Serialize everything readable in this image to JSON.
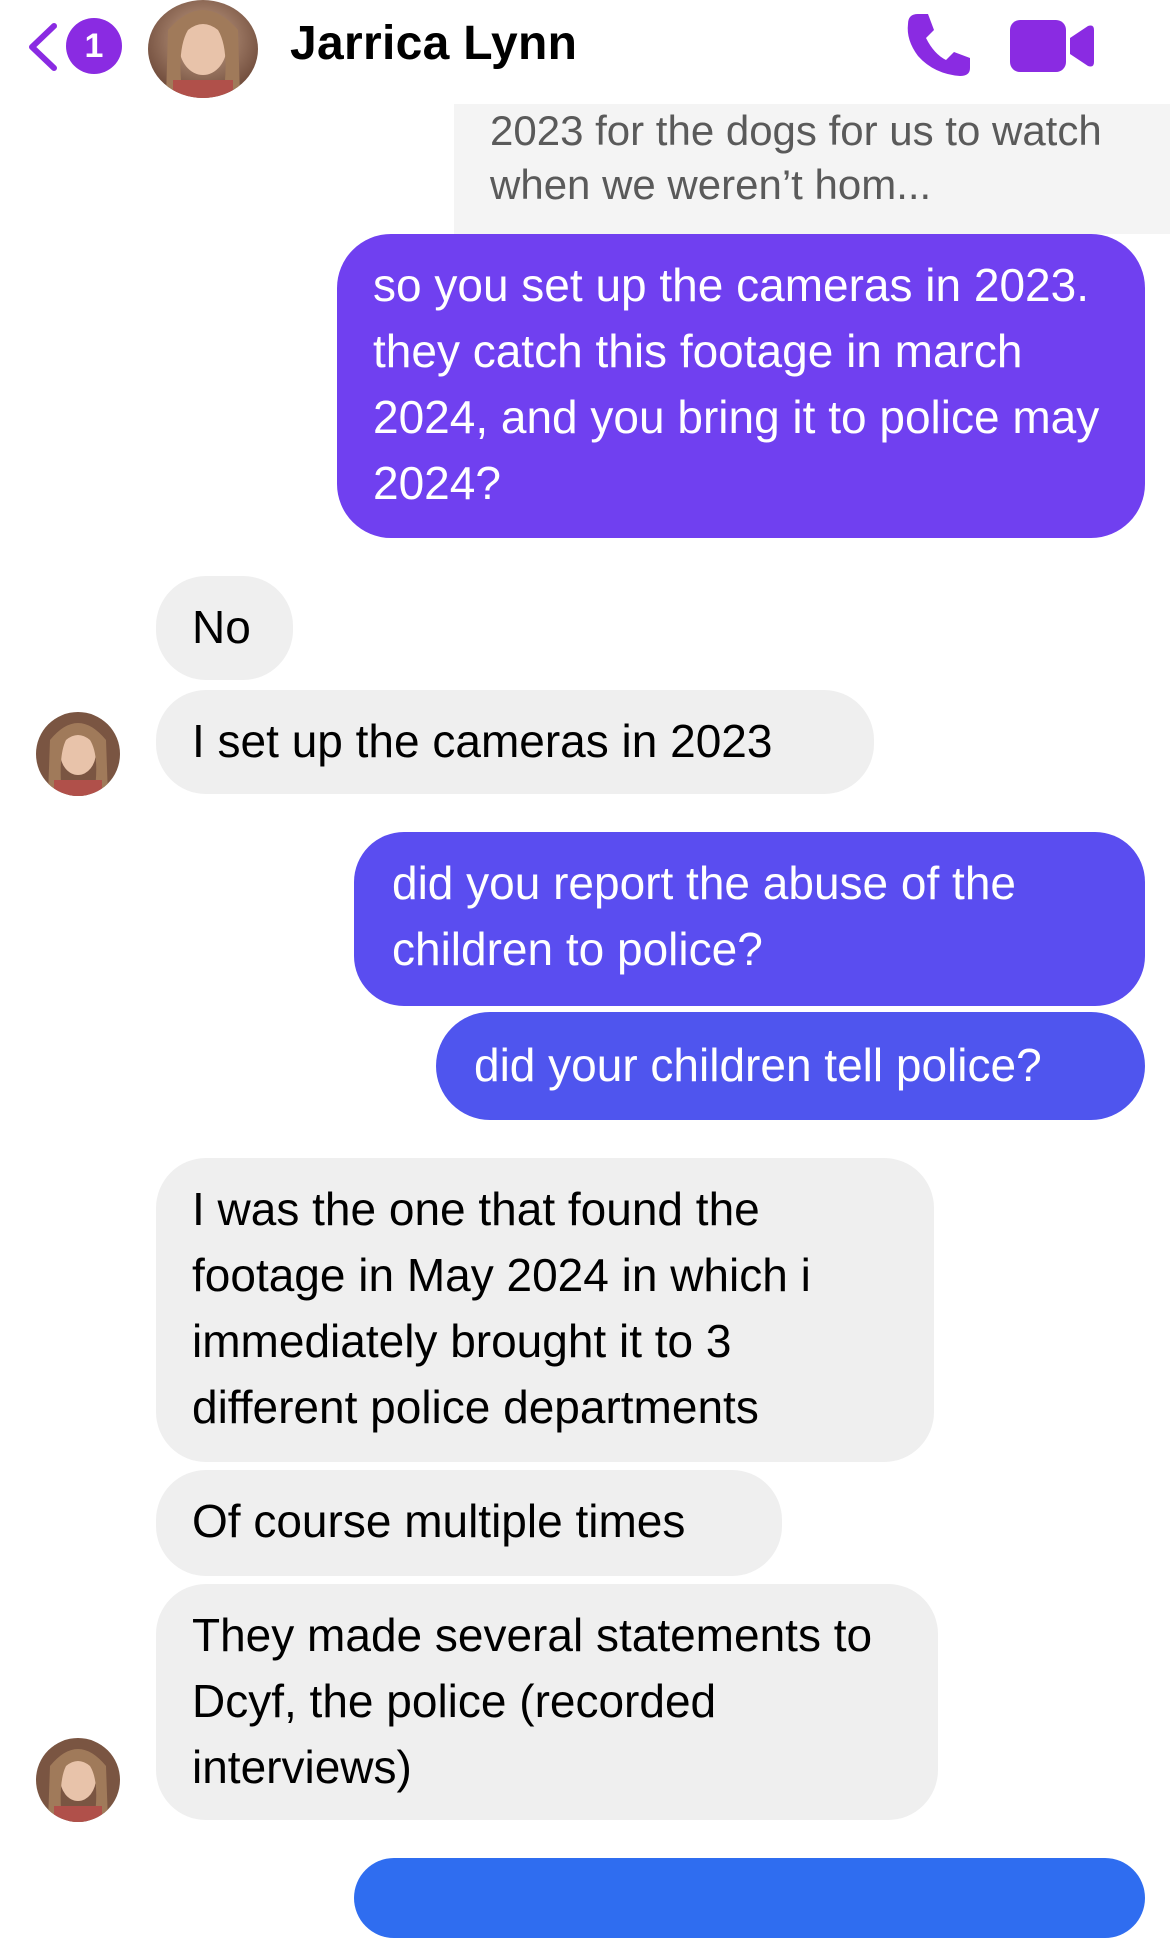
{
  "header": {
    "unread_count": "1",
    "contact_name": "Jarrica Lynn",
    "icons": {
      "back": "chevron-left-icon",
      "phone": "phone-icon",
      "video": "video-camera-icon"
    },
    "accent_color": "#8a2be2"
  },
  "quoted_message": {
    "text": "2023 for the dogs for us to watch when we weren’t hom..."
  },
  "messages": [
    {
      "direction": "outgoing",
      "text": "so you set up the cameras in 2023. they catch this footage in march 2024, and you bring it to police may 2024?",
      "color": "#7040f0"
    },
    {
      "direction": "incoming",
      "text": "No"
    },
    {
      "direction": "incoming",
      "text": "I set up the cameras in 2023"
    },
    {
      "direction": "outgoing",
      "text": "did you report the abuse of the children to police?",
      "color": "#5a4df0"
    },
    {
      "direction": "outgoing",
      "text": "did your children tell police?",
      "color": "#4f55ee"
    },
    {
      "direction": "incoming",
      "text": "I was the one that found the footage in May 2024 in which i immediately brought it to 3 different police departments"
    },
    {
      "direction": "incoming",
      "text": "Of course multiple times"
    },
    {
      "direction": "incoming",
      "text": "They made several statements to Dcyf, the police (recorded interviews)"
    }
  ]
}
